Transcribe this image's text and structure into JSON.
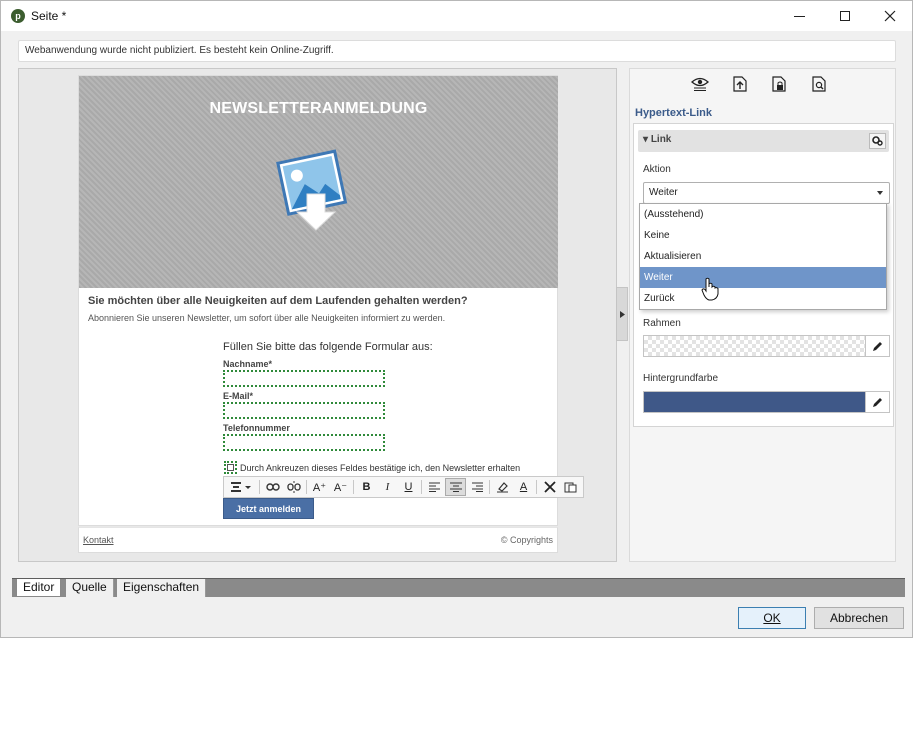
{
  "window": {
    "title": "Seite *",
    "app_icon_glyph": "p"
  },
  "notice": "Webanwendung wurde nicht publiziert. Es besteht kein Online-Zugriff.",
  "email": {
    "hero_title": "NEWSLETTERANMELDUNG",
    "headline": "Sie möchten über alle Neuigkeiten auf dem Laufenden gehalten werden?",
    "subline": "Abonnieren Sie unseren Newsletter, um sofort über alle Neuigkeiten informiert zu werden.",
    "form_title": "Füllen Sie bitte das folgende Formular aus:",
    "fields": [
      {
        "label": "Nachname*"
      },
      {
        "label": "E-Mail*"
      },
      {
        "label": "Telefonnummer"
      }
    ],
    "checkbox_text": "Durch Ankreuzen dieses Feldes bestätige ich, den Newsletter erhalten",
    "submit_label": "Jetzt anmelden",
    "footer_link": "Kontakt",
    "footer_copyright": "© Copyrights"
  },
  "toolbar_icons": [
    "format-icon",
    "link-icon",
    "unlink-icon",
    "font-increase-icon",
    "font-decrease-icon",
    "bold-icon",
    "italic-icon",
    "underline-icon",
    "align-left-icon",
    "align-center-icon",
    "align-right-icon",
    "highlight-icon",
    "font-color-icon",
    "clear-format-icon",
    "paste-icon"
  ],
  "toolbar_glyphs": {
    "bold": "B",
    "italic": "I",
    "underline": "U",
    "font_color": "A",
    "font_increase": "A⁺",
    "font_decrease": "A⁻"
  },
  "props": {
    "heading": "Hypertext-Link",
    "panel_title": "Link",
    "action_label": "Aktion",
    "action_value": "Weiter",
    "frame_label": "Rahmen",
    "bgcolor_label": "Hintergrundfarbe",
    "bgcolor_value": "#3f5888"
  },
  "dropdown": {
    "options": [
      "(Ausstehend)",
      "Keine",
      "Aktualisieren",
      "Weiter",
      "Zurück"
    ],
    "selected_index": 3
  },
  "tabs": [
    "Editor",
    "Quelle",
    "Eigenschaften"
  ],
  "active_tab": "Editor",
  "buttons": {
    "ok": "OK",
    "cancel": "Abbrechen"
  },
  "colors": {
    "accent": "#4a6fa5",
    "field_border": "#2f8a3a",
    "selected_option": "#6f95c9"
  }
}
